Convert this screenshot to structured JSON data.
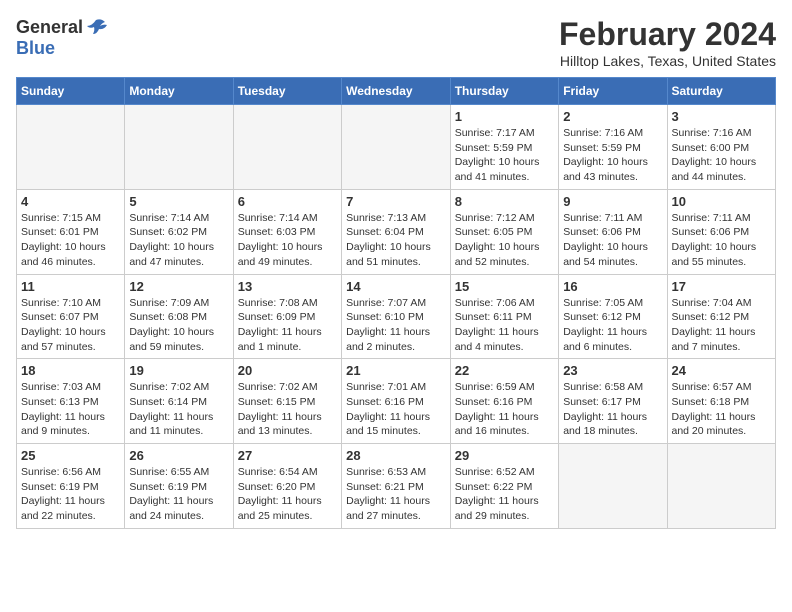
{
  "header": {
    "logo_general": "General",
    "logo_blue": "Blue",
    "month_title": "February 2024",
    "location": "Hilltop Lakes, Texas, United States"
  },
  "days_of_week": [
    "Sunday",
    "Monday",
    "Tuesday",
    "Wednesday",
    "Thursday",
    "Friday",
    "Saturday"
  ],
  "weeks": [
    [
      {
        "day": "",
        "sunrise": "",
        "sunset": "",
        "daylight": "",
        "empty": true
      },
      {
        "day": "",
        "sunrise": "",
        "sunset": "",
        "daylight": "",
        "empty": true
      },
      {
        "day": "",
        "sunrise": "",
        "sunset": "",
        "daylight": "",
        "empty": true
      },
      {
        "day": "",
        "sunrise": "",
        "sunset": "",
        "daylight": "",
        "empty": true
      },
      {
        "day": "1",
        "sunrise": "Sunrise: 7:17 AM",
        "sunset": "Sunset: 5:59 PM",
        "daylight": "Daylight: 10 hours and 41 minutes."
      },
      {
        "day": "2",
        "sunrise": "Sunrise: 7:16 AM",
        "sunset": "Sunset: 5:59 PM",
        "daylight": "Daylight: 10 hours and 43 minutes."
      },
      {
        "day": "3",
        "sunrise": "Sunrise: 7:16 AM",
        "sunset": "Sunset: 6:00 PM",
        "daylight": "Daylight: 10 hours and 44 minutes."
      }
    ],
    [
      {
        "day": "4",
        "sunrise": "Sunrise: 7:15 AM",
        "sunset": "Sunset: 6:01 PM",
        "daylight": "Daylight: 10 hours and 46 minutes."
      },
      {
        "day": "5",
        "sunrise": "Sunrise: 7:14 AM",
        "sunset": "Sunset: 6:02 PM",
        "daylight": "Daylight: 10 hours and 47 minutes."
      },
      {
        "day": "6",
        "sunrise": "Sunrise: 7:14 AM",
        "sunset": "Sunset: 6:03 PM",
        "daylight": "Daylight: 10 hours and 49 minutes."
      },
      {
        "day": "7",
        "sunrise": "Sunrise: 7:13 AM",
        "sunset": "Sunset: 6:04 PM",
        "daylight": "Daylight: 10 hours and 51 minutes."
      },
      {
        "day": "8",
        "sunrise": "Sunrise: 7:12 AM",
        "sunset": "Sunset: 6:05 PM",
        "daylight": "Daylight: 10 hours and 52 minutes."
      },
      {
        "day": "9",
        "sunrise": "Sunrise: 7:11 AM",
        "sunset": "Sunset: 6:06 PM",
        "daylight": "Daylight: 10 hours and 54 minutes."
      },
      {
        "day": "10",
        "sunrise": "Sunrise: 7:11 AM",
        "sunset": "Sunset: 6:06 PM",
        "daylight": "Daylight: 10 hours and 55 minutes."
      }
    ],
    [
      {
        "day": "11",
        "sunrise": "Sunrise: 7:10 AM",
        "sunset": "Sunset: 6:07 PM",
        "daylight": "Daylight: 10 hours and 57 minutes."
      },
      {
        "day": "12",
        "sunrise": "Sunrise: 7:09 AM",
        "sunset": "Sunset: 6:08 PM",
        "daylight": "Daylight: 10 hours and 59 minutes."
      },
      {
        "day": "13",
        "sunrise": "Sunrise: 7:08 AM",
        "sunset": "Sunset: 6:09 PM",
        "daylight": "Daylight: 11 hours and 1 minute."
      },
      {
        "day": "14",
        "sunrise": "Sunrise: 7:07 AM",
        "sunset": "Sunset: 6:10 PM",
        "daylight": "Daylight: 11 hours and 2 minutes."
      },
      {
        "day": "15",
        "sunrise": "Sunrise: 7:06 AM",
        "sunset": "Sunset: 6:11 PM",
        "daylight": "Daylight: 11 hours and 4 minutes."
      },
      {
        "day": "16",
        "sunrise": "Sunrise: 7:05 AM",
        "sunset": "Sunset: 6:12 PM",
        "daylight": "Daylight: 11 hours and 6 minutes."
      },
      {
        "day": "17",
        "sunrise": "Sunrise: 7:04 AM",
        "sunset": "Sunset: 6:12 PM",
        "daylight": "Daylight: 11 hours and 7 minutes."
      }
    ],
    [
      {
        "day": "18",
        "sunrise": "Sunrise: 7:03 AM",
        "sunset": "Sunset: 6:13 PM",
        "daylight": "Daylight: 11 hours and 9 minutes."
      },
      {
        "day": "19",
        "sunrise": "Sunrise: 7:02 AM",
        "sunset": "Sunset: 6:14 PM",
        "daylight": "Daylight: 11 hours and 11 minutes."
      },
      {
        "day": "20",
        "sunrise": "Sunrise: 7:02 AM",
        "sunset": "Sunset: 6:15 PM",
        "daylight": "Daylight: 11 hours and 13 minutes."
      },
      {
        "day": "21",
        "sunrise": "Sunrise: 7:01 AM",
        "sunset": "Sunset: 6:16 PM",
        "daylight": "Daylight: 11 hours and 15 minutes."
      },
      {
        "day": "22",
        "sunrise": "Sunrise: 6:59 AM",
        "sunset": "Sunset: 6:16 PM",
        "daylight": "Daylight: 11 hours and 16 minutes."
      },
      {
        "day": "23",
        "sunrise": "Sunrise: 6:58 AM",
        "sunset": "Sunset: 6:17 PM",
        "daylight": "Daylight: 11 hours and 18 minutes."
      },
      {
        "day": "24",
        "sunrise": "Sunrise: 6:57 AM",
        "sunset": "Sunset: 6:18 PM",
        "daylight": "Daylight: 11 hours and 20 minutes."
      }
    ],
    [
      {
        "day": "25",
        "sunrise": "Sunrise: 6:56 AM",
        "sunset": "Sunset: 6:19 PM",
        "daylight": "Daylight: 11 hours and 22 minutes."
      },
      {
        "day": "26",
        "sunrise": "Sunrise: 6:55 AM",
        "sunset": "Sunset: 6:19 PM",
        "daylight": "Daylight: 11 hours and 24 minutes."
      },
      {
        "day": "27",
        "sunrise": "Sunrise: 6:54 AM",
        "sunset": "Sunset: 6:20 PM",
        "daylight": "Daylight: 11 hours and 25 minutes."
      },
      {
        "day": "28",
        "sunrise": "Sunrise: 6:53 AM",
        "sunset": "Sunset: 6:21 PM",
        "daylight": "Daylight: 11 hours and 27 minutes."
      },
      {
        "day": "29",
        "sunrise": "Sunrise: 6:52 AM",
        "sunset": "Sunset: 6:22 PM",
        "daylight": "Daylight: 11 hours and 29 minutes."
      },
      {
        "day": "",
        "sunrise": "",
        "sunset": "",
        "daylight": "",
        "empty": true
      },
      {
        "day": "",
        "sunrise": "",
        "sunset": "",
        "daylight": "",
        "empty": true
      }
    ]
  ]
}
